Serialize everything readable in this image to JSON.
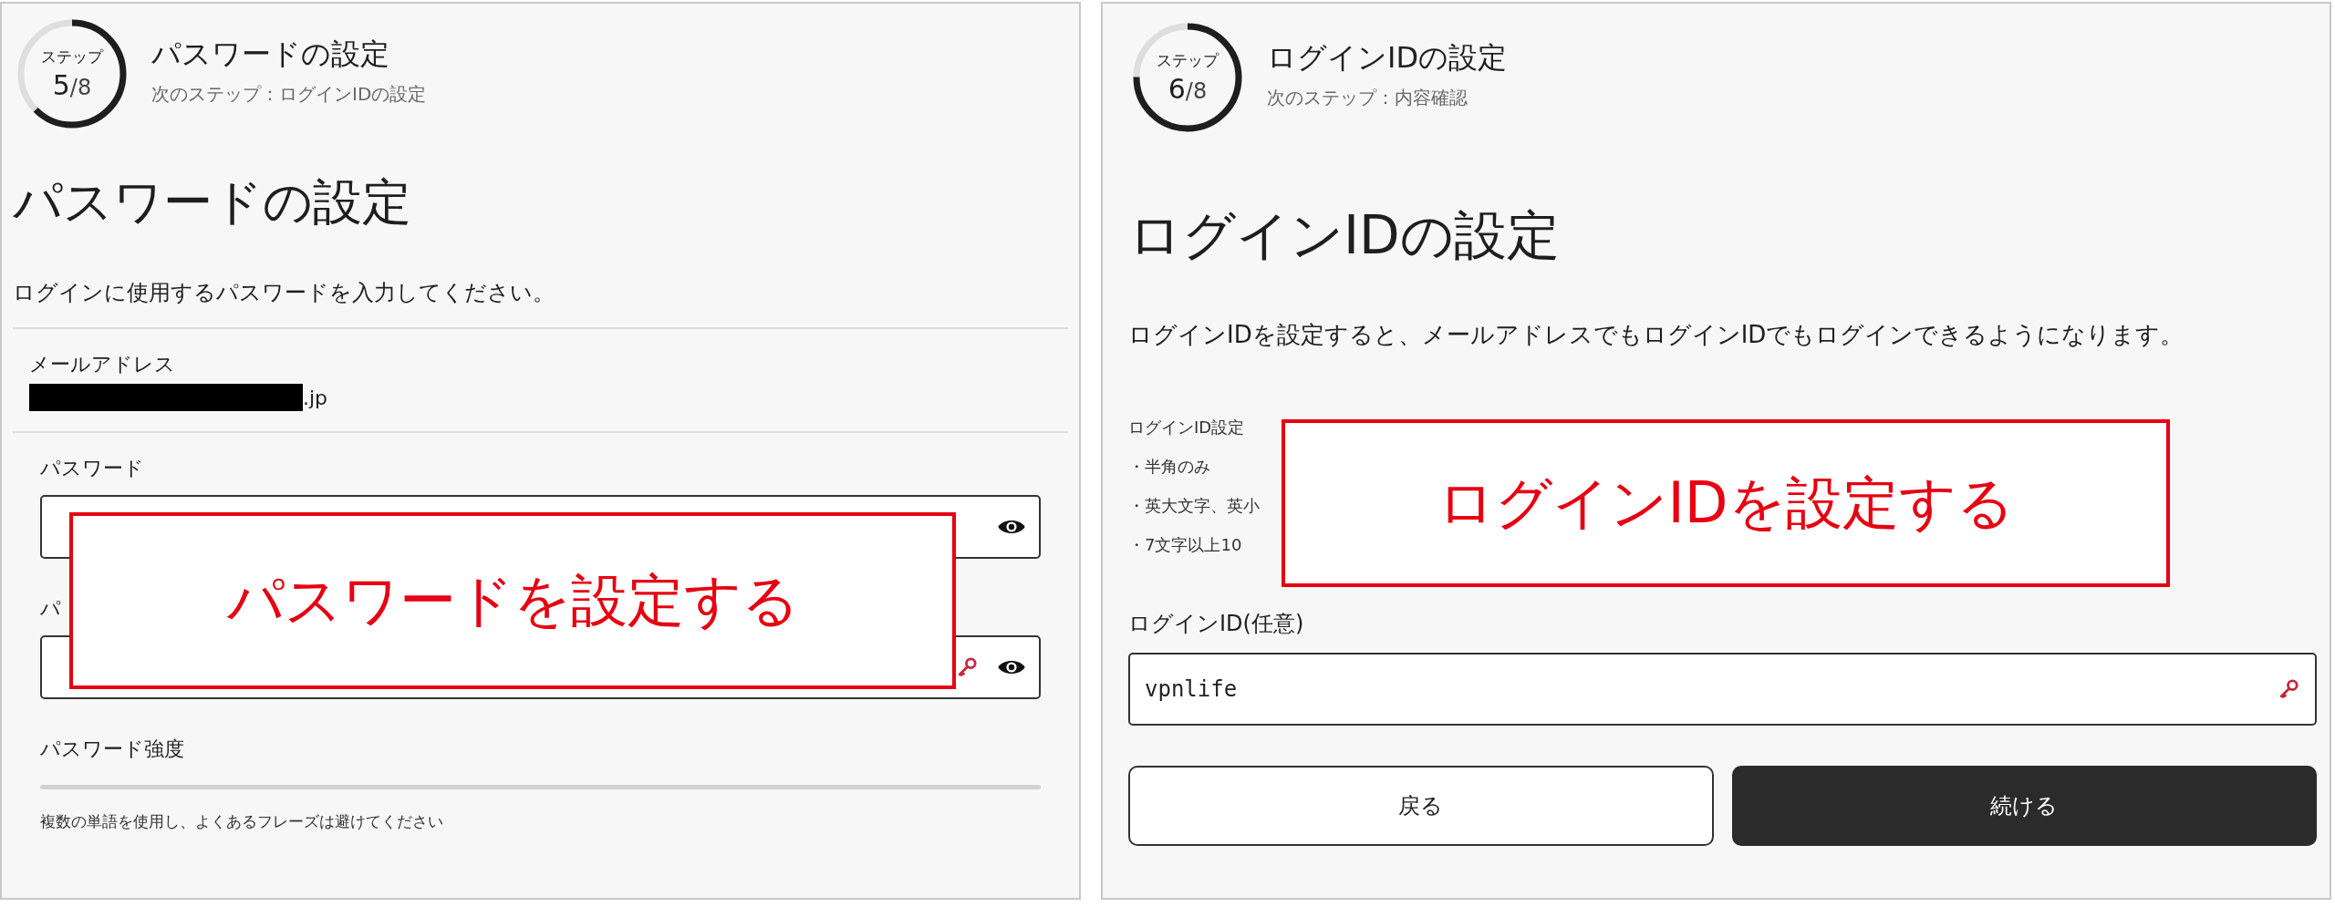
{
  "password_panel": {
    "step": {
      "label": "ステップ",
      "current": "5",
      "total": "/8",
      "level": 0.625
    },
    "title": "パスワードの設定",
    "next_step": "次のステップ：ログインIDの設定",
    "heading": "パスワードの設定",
    "description": "ログインに使用するパスワードを入力してください。",
    "email": {
      "label": "メールアドレス",
      "redacted": true,
      "value": ".jp"
    },
    "password": {
      "label": "パスワード"
    },
    "confirm": {
      "label": "パ"
    },
    "strength": {
      "label": "パスワード強度",
      "level": 0,
      "hint": "複数の単語を使用し、よくあるフレーズは避けてください"
    },
    "callout": "パスワードを設定する"
  },
  "login_id_panel": {
    "step": {
      "label": "ステップ",
      "current": "6",
      "total": "/8",
      "level": 0.75
    },
    "title": "ログインIDの設定",
    "next_step": "次のステップ：内容確認",
    "heading": "ログインIDの設定",
    "description": "ログインIDを設定すると、メールアドレスでもログインIDでもログインできるようになります。",
    "rules": {
      "title": "ログインID設定",
      "items": [
        "・半角のみ",
        "・英大文字、英小",
        "・7文字以上10"
      ]
    },
    "login_id": {
      "label": "ログインID(任意)",
      "value": "vpnlife"
    },
    "buttons": [
      {
        "label": "戻る",
        "kind": "secondary"
      },
      {
        "label": "続ける",
        "kind": "primary"
      }
    ],
    "callout": "ログインIDを設定する"
  }
}
